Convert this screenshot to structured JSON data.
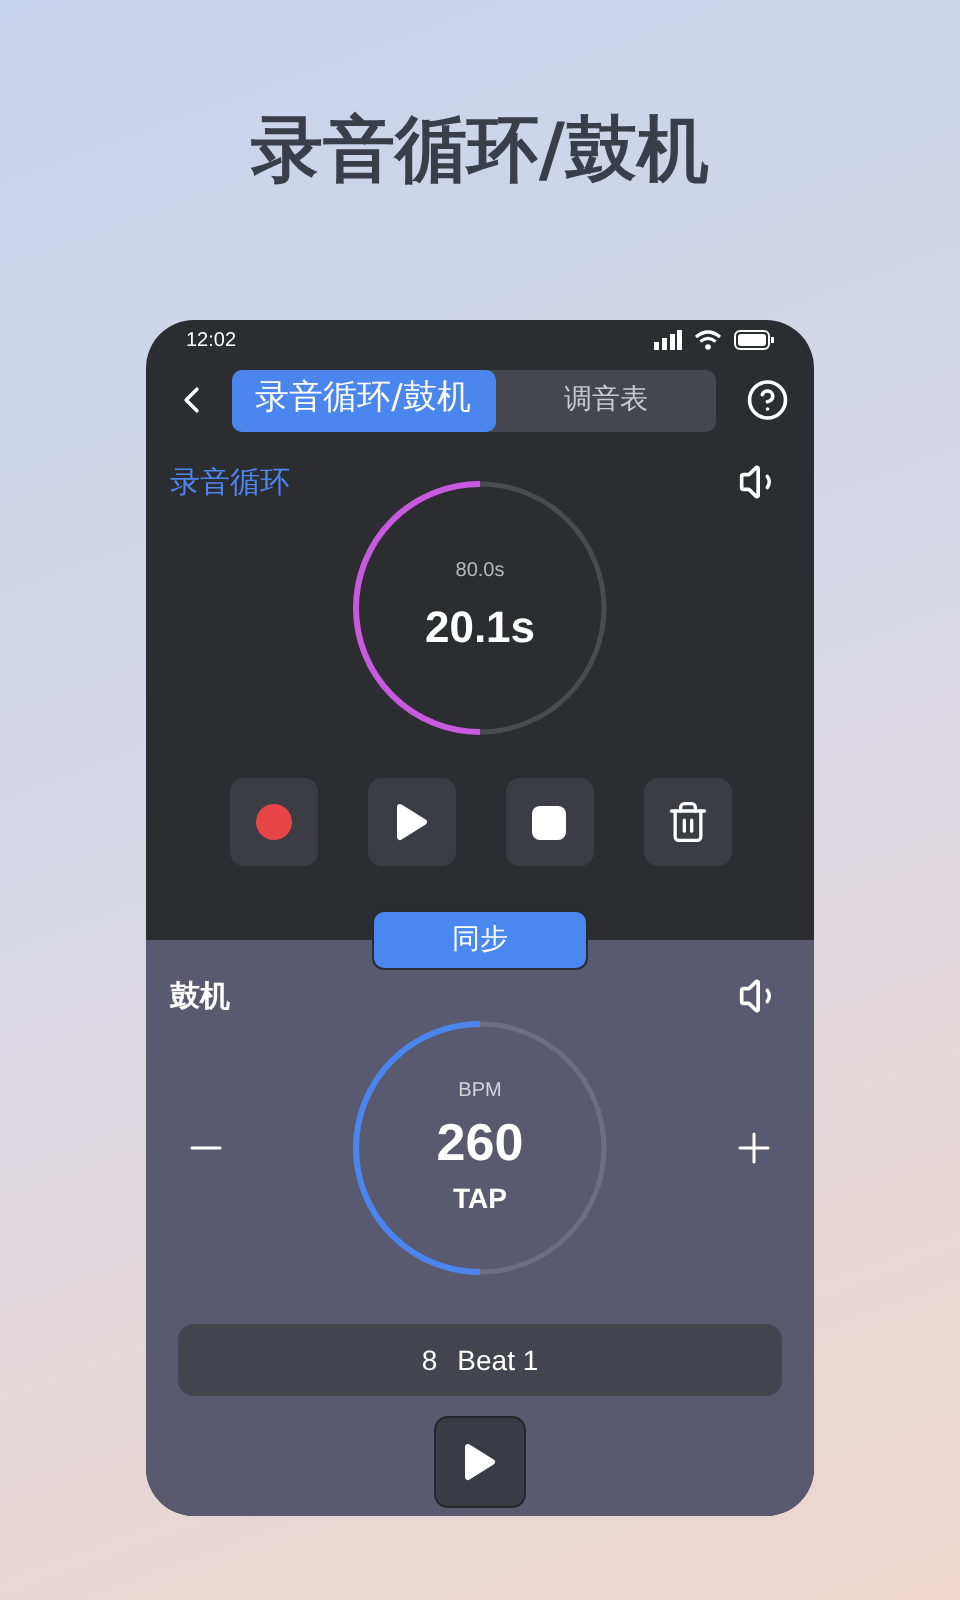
{
  "headline": "录音循环/鼓机",
  "status_bar": {
    "time": "12:02"
  },
  "tabs": [
    {
      "label": "录音循环/鼓机",
      "selected": true
    },
    {
      "label": "调音表",
      "selected": false
    }
  ],
  "loop": {
    "title": "录音循环",
    "ring": {
      "total": "80.0s",
      "elapsed": "20.1s",
      "level": 0.5
    },
    "controls": [
      {
        "kind": "record"
      },
      {
        "kind": "play"
      },
      {
        "kind": "stop"
      },
      {
        "kind": "delete"
      }
    ]
  },
  "sync_button": "同步",
  "drum": {
    "title": "鼓机",
    "ring": {
      "caption": "BPM",
      "value": "260",
      "tap": "TAP",
      "level": 0.5
    },
    "beat": {
      "count": "8",
      "label": "Beat 1"
    }
  }
}
